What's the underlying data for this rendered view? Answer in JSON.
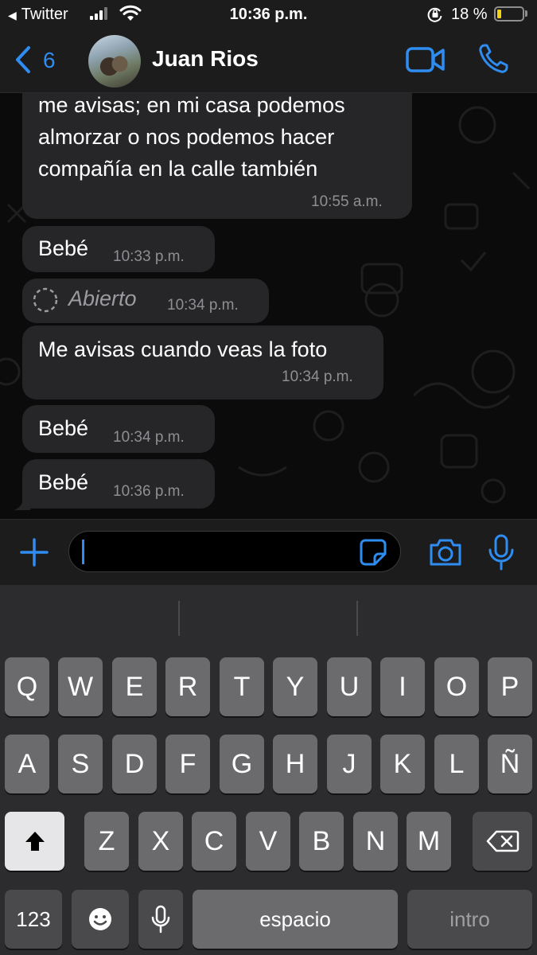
{
  "status_bar": {
    "back_app": "Twitter",
    "time": "10:36 p.m.",
    "battery": "18 %",
    "battery_level": 0.18
  },
  "header": {
    "unread_count": "6",
    "contact_name": "Juan Rios"
  },
  "messages": [
    {
      "lines": [
        "me avisas; en mi casa podemos",
        "almorzar o nos podemos hacer",
        "compañía en la calle también"
      ],
      "time": "10:55 a.m."
    },
    {
      "text": "Bebé",
      "time": "10:33 p.m."
    },
    {
      "text": "Abierto",
      "time": "10:34 p.m.",
      "type": "view-once-opened"
    },
    {
      "text": "Me avisas cuando veas la foto",
      "time": "10:34 p.m."
    },
    {
      "text": "Bebé",
      "time": "10:34 p.m."
    },
    {
      "text": "Bebé",
      "time": "10:36 p.m."
    }
  ],
  "colors": {
    "accent": "#2f8cf0",
    "bubble": "#262628",
    "bar": "#1c1c1d"
  },
  "keyboard": {
    "row1": [
      "Q",
      "W",
      "E",
      "R",
      "T",
      "Y",
      "U",
      "I",
      "O",
      "P"
    ],
    "row2": [
      "A",
      "S",
      "D",
      "F",
      "G",
      "H",
      "J",
      "K",
      "L",
      "Ñ"
    ],
    "row3": [
      "Z",
      "X",
      "C",
      "V",
      "B",
      "N",
      "M"
    ],
    "numbers_key": "123",
    "space_key": "espacio",
    "return_key": "intro"
  },
  "icons": [
    "back-chevron-icon",
    "video-call-icon",
    "phone-icon",
    "plus-icon",
    "sticker-icon",
    "camera-icon",
    "microphone-icon",
    "shift-icon",
    "backspace-icon",
    "emoji-icon",
    "dictation-icon"
  ]
}
